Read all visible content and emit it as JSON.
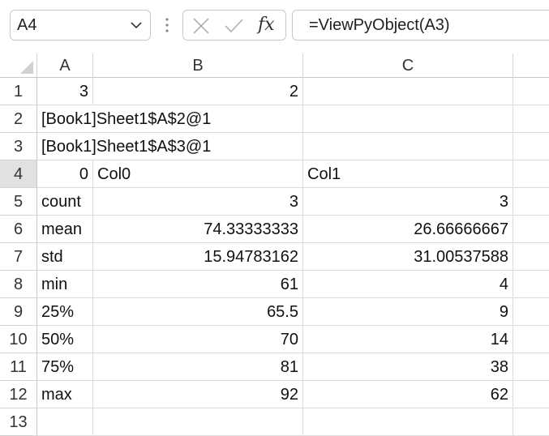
{
  "formula_bar": {
    "name_box": "A4",
    "formula": "=ViewPyObject(A3)",
    "icons": [
      "chevron-down-icon",
      "grip-icon",
      "cancel-icon",
      "enter-check-icon",
      "insert-function-icon"
    ]
  },
  "columns": [
    "A",
    "B",
    "C"
  ],
  "rows": [
    "1",
    "2",
    "3",
    "4",
    "5",
    "6",
    "7",
    "8",
    "9",
    "10",
    "11",
    "12",
    "13"
  ],
  "selected_row": "4",
  "cells": {
    "r1": {
      "a": "3",
      "b": "2",
      "c": ""
    },
    "r2": {
      "a": "[Book1]Sheet1$A$2@1",
      "b": "",
      "c": ""
    },
    "r3": {
      "a": "[Book1]Sheet1$A$3@1",
      "b": "",
      "c": ""
    },
    "r4": {
      "a": "0",
      "b": "Col0",
      "c": "Col1"
    },
    "r5": {
      "a": "count",
      "b": "3",
      "c": "3"
    },
    "r6": {
      "a": "mean",
      "b": "74.33333333",
      "c": "26.66666667"
    },
    "r7": {
      "a": "std",
      "b": "15.94783162",
      "c": "31.00537588"
    },
    "r8": {
      "a": "min",
      "b": "61",
      "c": "4"
    },
    "r9": {
      "a": "25%",
      "b": "65.5",
      "c": "9"
    },
    "r10": {
      "a": "50%",
      "b": "70",
      "c": "14"
    },
    "r11": {
      "a": "75%",
      "b": "81",
      "c": "38"
    },
    "r12": {
      "a": "max",
      "b": "92",
      "c": "62"
    },
    "r13": {
      "a": "",
      "b": "",
      "c": ""
    }
  }
}
